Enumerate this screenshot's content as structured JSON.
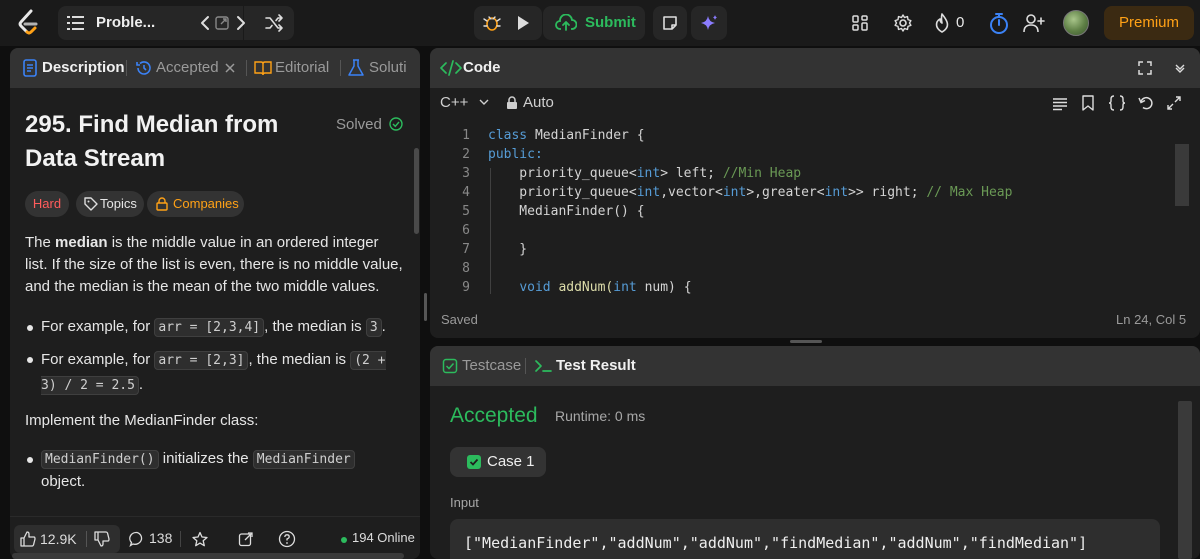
{
  "topbar": {
    "problem_list_label": "Proble...",
    "submit_label": "Submit",
    "streak_count": "0",
    "premium_label": "Premium"
  },
  "left_tabs": {
    "description": "Description",
    "accepted": "Accepted",
    "editorial": "Editorial",
    "solutions": "Soluti"
  },
  "problem": {
    "title": "295. Find Median from Data Stream",
    "status": "Solved",
    "difficulty": "Hard",
    "topics": "Topics",
    "companies": "Companies",
    "intro_pre": "The ",
    "intro_bold": "median",
    "intro_post": " is the middle value in an ordered integer list. If the size of the list is even, there is no middle value, and the median is the mean of the two middle values.",
    "ex1_pre": "For example, for ",
    "ex1_code": "arr = [2,3,4]",
    "ex1_mid": ", the median is ",
    "ex1_val": "3",
    "ex1_end": ".",
    "ex2_pre": "For example, for ",
    "ex2_code": "arr = [2,3]",
    "ex2_mid": ", the median is ",
    "ex2_val": "(2 + 3) / 2 = 2.5",
    "ex2_end": ".",
    "implement": "Implement the MedianFinder class:",
    "item1_code": "MedianFinder()",
    "item1_mid": " initializes the ",
    "item1_code2": "MedianFinder",
    "item1_end": " object."
  },
  "left_footer": {
    "likes": "12.9K",
    "comments": "138",
    "online": "194 Online"
  },
  "code_panel": {
    "title": "Code",
    "language": "C++",
    "mode": "Auto",
    "saved": "Saved",
    "cursor": "Ln 24, Col 5",
    "lines": [
      {
        "n": "1",
        "tokens": [
          {
            "t": "class ",
            "c": "kw"
          },
          {
            "t": "MedianFinder {",
            "c": ""
          }
        ]
      },
      {
        "n": "2",
        "tokens": [
          {
            "t": "public:",
            "c": "kw"
          }
        ]
      },
      {
        "n": "3",
        "tokens": [
          {
            "t": "    priority_queue<",
            "c": ""
          },
          {
            "t": "int",
            "c": "kw"
          },
          {
            "t": "> left; ",
            "c": ""
          },
          {
            "t": "//Min Heap",
            "c": "cm"
          }
        ]
      },
      {
        "n": "4",
        "tokens": [
          {
            "t": "    priority_queue<",
            "c": ""
          },
          {
            "t": "int",
            "c": "kw"
          },
          {
            "t": ",vector<",
            "c": ""
          },
          {
            "t": "int",
            "c": "kw"
          },
          {
            "t": ">,greater<",
            "c": ""
          },
          {
            "t": "int",
            "c": "kw"
          },
          {
            "t": ">> right; ",
            "c": ""
          },
          {
            "t": "// Max Heap",
            "c": "cm"
          }
        ]
      },
      {
        "n": "5",
        "tokens": [
          {
            "t": "    MedianFinder() {",
            "c": ""
          }
        ]
      },
      {
        "n": "6",
        "tokens": [
          {
            "t": "",
            "c": ""
          }
        ]
      },
      {
        "n": "7",
        "tokens": [
          {
            "t": "    }",
            "c": ""
          }
        ]
      },
      {
        "n": "8",
        "tokens": [
          {
            "t": "",
            "c": ""
          }
        ]
      },
      {
        "n": "9",
        "tokens": [
          {
            "t": "    ",
            "c": ""
          },
          {
            "t": "void ",
            "c": "kw"
          },
          {
            "t": "addNum(",
            "c": "fn"
          },
          {
            "t": "int ",
            "c": "kw"
          },
          {
            "t": "num) {",
            "c": ""
          }
        ]
      }
    ]
  },
  "test_panel": {
    "tab_testcase": "Testcase",
    "tab_result": "Test Result",
    "verdict": "Accepted",
    "runtime": "Runtime: 0 ms",
    "case_label": "Case 1",
    "input_label": "Input",
    "input_value": "[\"MedianFinder\",\"addNum\",\"addNum\",\"findMedian\",\"addNum\",\"findMedian\"]"
  },
  "colors": {
    "accent_green": "#2cbb5d",
    "premium_orange": "#ffa116",
    "hard_red": "#ff5c5c",
    "link_blue": "#3b82f6"
  }
}
